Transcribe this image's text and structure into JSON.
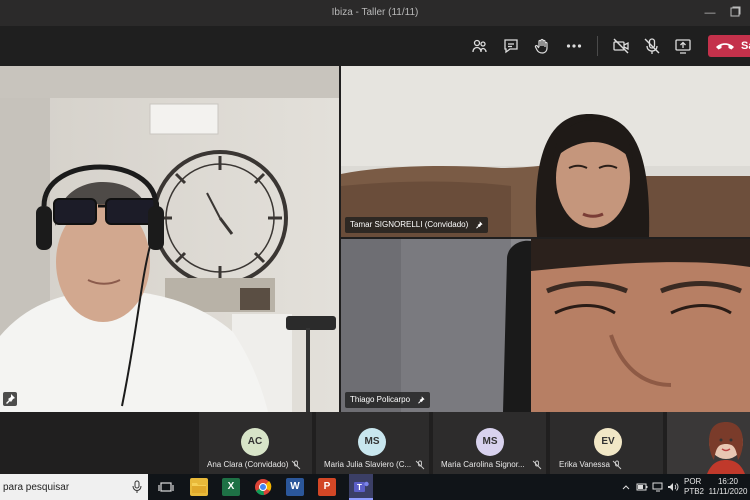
{
  "window": {
    "title": "Ibiza - Taller (11/11)"
  },
  "toolbar": {
    "leave_label": "Sa"
  },
  "tiles": [
    {
      "name": ""
    },
    {
      "name": "Tamar SIGNORELLI (Convidado)"
    },
    {
      "name": "Thiago Policarpo"
    }
  ],
  "participants": [
    {
      "initials": "AC",
      "name": "Ana Clara (Convidado)",
      "color": "#d7e4c8"
    },
    {
      "initials": "MS",
      "name": "Maria Julia Slaviero (C...",
      "color": "#c8e6ee"
    },
    {
      "initials": "MS",
      "name": "Maria Carolina Signor...",
      "color": "#d8d2ee"
    },
    {
      "initials": "EV",
      "name": "Erika Vanessa",
      "color": "#f1e7c6"
    }
  ],
  "taskbar": {
    "search_text": "para pesquisar",
    "lang_top": "POR",
    "lang_bottom": "PTB2",
    "time": "16:20",
    "date": "11/11/2020"
  }
}
